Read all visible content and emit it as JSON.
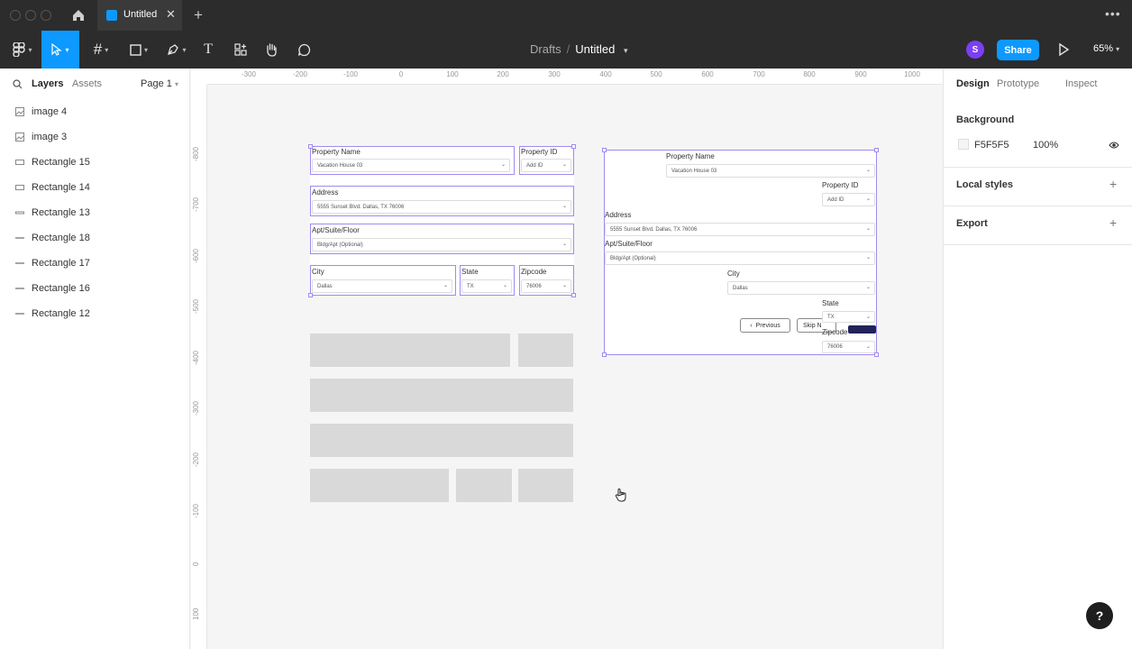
{
  "tab": {
    "title": "Untitled",
    "close": "✕",
    "new": "+"
  },
  "menu": {
    "more": "•••"
  },
  "toolbar": {
    "breadcrumb_parent": "Drafts",
    "breadcrumb_sep": "/",
    "file_name": "Untitled",
    "caret": "⌄",
    "avatar_initial": "S",
    "share_label": "Share",
    "zoom": "65%"
  },
  "left_panel": {
    "tab_layers": "Layers",
    "tab_assets": "Assets",
    "page": "Page 1",
    "layers": [
      {
        "label": "image 4",
        "icon": "image-icon"
      },
      {
        "label": "image 3",
        "icon": "image-icon"
      },
      {
        "label": "Rectangle 15",
        "icon": "rectangle-icon"
      },
      {
        "label": "Rectangle 14",
        "icon": "rectangle-icon"
      },
      {
        "label": "Rectangle 13",
        "icon": "line-icon"
      },
      {
        "label": "Rectangle 18",
        "icon": "line-icon"
      },
      {
        "label": "Rectangle 17",
        "icon": "line-icon"
      },
      {
        "label": "Rectangle 16",
        "icon": "line-icon"
      },
      {
        "label": "Rectangle 12",
        "icon": "line-icon"
      }
    ]
  },
  "rulers": {
    "top": [
      "-300",
      "-200",
      "-100",
      "0",
      "100",
      "200",
      "300",
      "400",
      "500",
      "600",
      "700",
      "800",
      "900",
      "1000"
    ],
    "left": [
      "-800",
      "-700",
      "-600",
      "-500",
      "-400",
      "-300",
      "-200",
      "-100",
      "0",
      "100"
    ]
  },
  "form": {
    "property_name_label": "Property Name",
    "property_name_value": "Vacation House 03",
    "property_id_label": "Property ID",
    "property_id_value": "Add ID",
    "address_label": "Address",
    "address_value": "5555 Sunset Blvd. Dallas, TX 76006",
    "apt_label": "Apt/Suite/Floor",
    "apt_value": "Bldg/Apt (Optional)",
    "city_label": "City",
    "city_value": "Dallas",
    "state_label": "State",
    "state_value": "TX",
    "zip_label": "Zipcode",
    "zip_value": "76006",
    "chevron": "⌄",
    "prev_label": "Previous",
    "skip_label": "Skip N"
  },
  "right_panel": {
    "tab_design": "Design",
    "tab_prototype": "Prototype",
    "tab_inspect": "Inspect",
    "background_title": "Background",
    "background_hex": "F5F5F5",
    "background_opacity": "100%",
    "background_color": "#f5f5f5",
    "local_styles_title": "Local styles",
    "export_title": "Export",
    "plus": "+",
    "help": "?"
  },
  "colors": {
    "accent": "#0d99ff",
    "selection": "#a18af2",
    "avatar": "#7b3ff2",
    "dark_chrome": "#2c2c2c"
  }
}
